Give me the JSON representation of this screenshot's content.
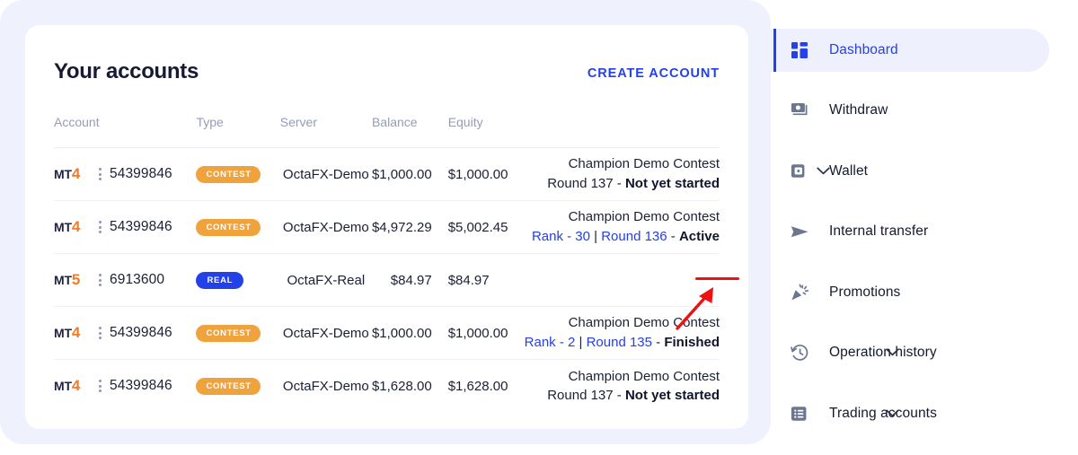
{
  "card": {
    "title": "Your accounts",
    "create_account_label": "CREATE ACCOUNT"
  },
  "table": {
    "headers": {
      "account": "Account",
      "type": "Type",
      "server": "Server",
      "balance": "Balance",
      "equity": "Equity",
      "status": ""
    },
    "rows": [
      {
        "platform_prefix": "MT",
        "platform_num": "4",
        "account_number": "54399846",
        "type_badge": "CONTEST",
        "type_badge_kind": "contest",
        "server": "OctaFX-Demo",
        "balance": "$1,000.00",
        "equity": "$1,000.00",
        "contest_name": "Champion Demo Contest",
        "rank_label": "",
        "round_label": "Round 137",
        "separator": " - ",
        "state": "Not yet started"
      },
      {
        "platform_prefix": "MT",
        "platform_num": "4",
        "account_number": "54399846",
        "type_badge": "CONTEST",
        "type_badge_kind": "contest",
        "server": "OctaFX-Demo",
        "balance": "$4,972.29",
        "equity": "$5,002.45",
        "contest_name": "Champion Demo Contest",
        "rank_label": "Rank - 30",
        "round_label": "Round 136",
        "separator": " - ",
        "state": "Active"
      },
      {
        "platform_prefix": "MT",
        "platform_num": "5",
        "account_number": "6913600",
        "type_badge": "REAL",
        "type_badge_kind": "real",
        "server": "OctaFX-Real",
        "balance": "$84.97",
        "equity": "$84.97",
        "contest_name": "",
        "rank_label": "",
        "round_label": "",
        "separator": "",
        "state": ""
      },
      {
        "platform_prefix": "MT",
        "platform_num": "4",
        "account_number": "54399846",
        "type_badge": "CONTEST",
        "type_badge_kind": "contest",
        "server": "OctaFX-Demo",
        "balance": "$1,000.00",
        "equity": "$1,000.00",
        "contest_name": "Champion Demo Contest",
        "rank_label": "Rank - 2",
        "round_label": "Round 135",
        "separator": " - ",
        "state": "Finished"
      },
      {
        "platform_prefix": "MT",
        "platform_num": "4",
        "account_number": "54399846",
        "type_badge": "CONTEST",
        "type_badge_kind": "contest",
        "server": "OctaFX-Demo",
        "balance": "$1,628.00",
        "equity": "$1,628.00",
        "contest_name": "Champion Demo Contest",
        "rank_label": "",
        "round_label": "Round 137",
        "separator": " - ",
        "state": "Not yet started"
      }
    ]
  },
  "sidebar": {
    "items": [
      {
        "label": "Dashboard",
        "icon": "dashboard-grid-icon",
        "active": true,
        "chevron": false
      },
      {
        "label": "Withdraw",
        "icon": "banknotes-icon",
        "active": false,
        "chevron": false
      },
      {
        "label": "Wallet",
        "icon": "wallet-card-icon",
        "active": false,
        "chevron": true
      },
      {
        "label": "Internal transfer",
        "icon": "send-arrow-icon",
        "active": false,
        "chevron": false
      },
      {
        "label": "Promotions",
        "icon": "party-popper-icon",
        "active": false,
        "chevron": false
      },
      {
        "label": "Operation history",
        "icon": "clock-rewind-icon",
        "active": false,
        "chevron": true
      },
      {
        "label": "Trading accounts",
        "icon": "list-box-icon",
        "active": false,
        "chevron": true
      }
    ]
  },
  "annotations": {
    "arrow_color": "#ee1111",
    "underline_color": "#ee1111",
    "points_at": "Active"
  },
  "colors": {
    "accent_blue": "#2440e8",
    "contest_orange": "#f0a33c",
    "platform_orange": "#f07c28",
    "page_background": "#eff2fc",
    "card_background": "#ffffff",
    "active_nav_bg": "#eef1fd",
    "muted_text": "#959cb5",
    "icon_gray": "#6b7690"
  }
}
